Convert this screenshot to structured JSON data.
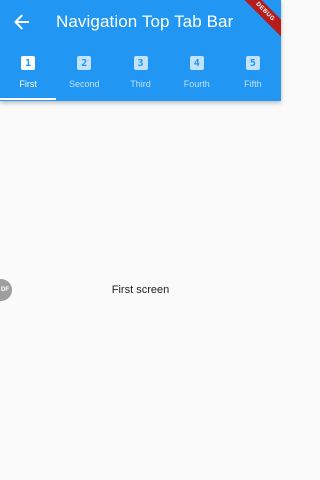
{
  "appbar": {
    "title": "Navigation Top Tab Bar",
    "back_icon": "arrow-left-icon",
    "color": "#2196f3"
  },
  "tabs": [
    {
      "label": "First",
      "icon_text": "1",
      "active": true
    },
    {
      "label": "Second",
      "icon_text": "2",
      "active": false
    },
    {
      "label": "Third",
      "icon_text": "3",
      "active": false
    },
    {
      "label": "Fourth",
      "icon_text": "4",
      "active": false
    },
    {
      "label": "Fifth",
      "icon_text": "5",
      "active": false
    }
  ],
  "content": {
    "text": "First screen"
  },
  "side_tab": {
    "label": "DF"
  },
  "debug_banner": {
    "label": "DEBUG"
  }
}
